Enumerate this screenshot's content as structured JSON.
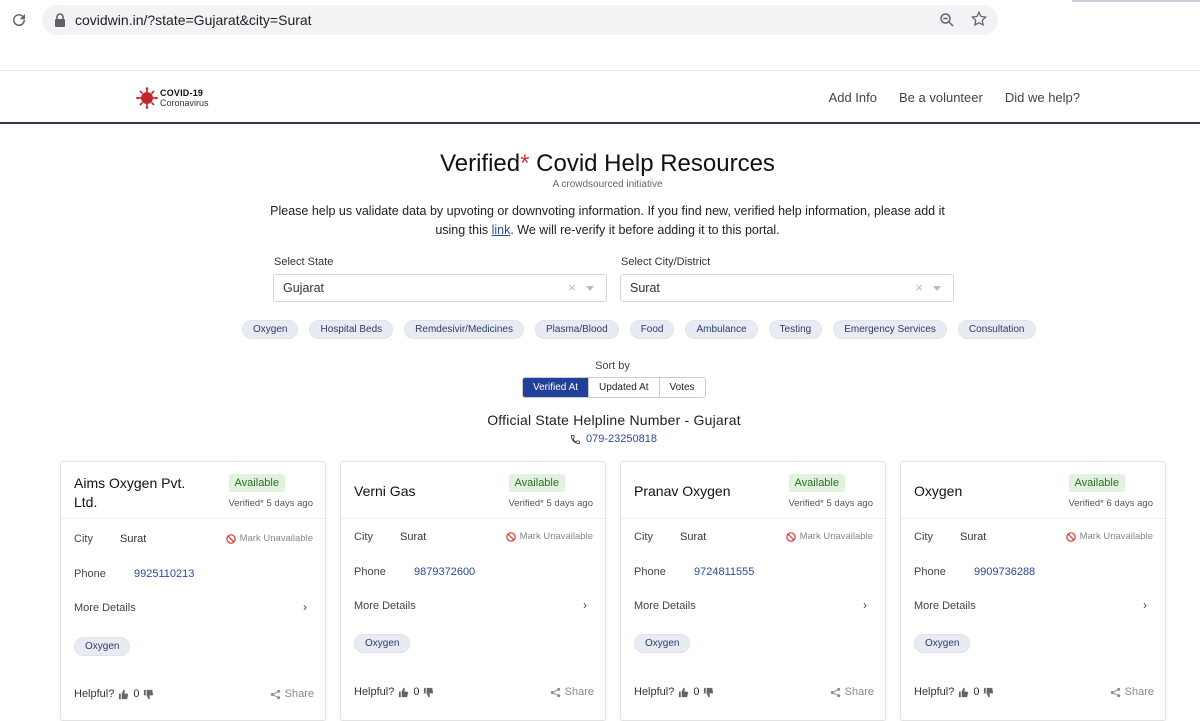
{
  "browser": {
    "url": "covidwin.in/?state=Gujarat&city=Surat"
  },
  "header": {
    "logo_title": "COVID-19",
    "logo_sub": "Coronavirus",
    "nav": [
      "Add Info",
      "Be a volunteer",
      "Did we help?"
    ]
  },
  "hero": {
    "title_a": "Verified",
    "title_star": "*",
    "title_b": " Covid Help Resources",
    "subtitle": "A crowdsourced initiative",
    "desc_1": "Please help us validate data by upvoting or downvoting information. If you find new, verified help information, please add it using this ",
    "desc_link": "link",
    "desc_2": ". We will re-verify it before adding it to this portal."
  },
  "filters": {
    "state_label": "Select State",
    "state_value": "Gujarat",
    "city_label": "Select City/District",
    "city_value": "Surat",
    "clear_glyph": "×"
  },
  "chips": [
    "Oxygen",
    "Hospital Beds",
    "Remdesivir/Medicines",
    "Plasma/Blood",
    "Food",
    "Ambulance",
    "Testing",
    "Emergency Services",
    "Consultation"
  ],
  "sort": {
    "label": "Sort by",
    "options": [
      "Verified At",
      "Updated At",
      "Votes"
    ],
    "active": "Verified At"
  },
  "helpline": {
    "title": "Official State Helpline Number - Gujarat",
    "phone": "079-23250818"
  },
  "card_labels": {
    "city": "City",
    "phone": "Phone",
    "more": "More Details",
    "mark_unavailable": "Mark Unavailable",
    "helpful": "Helpful?",
    "share": "Share",
    "more_chevron": "›"
  },
  "cards": [
    {
      "name": "Aims Oxygen Pvt. Ltd.",
      "status": "Available",
      "verified": "Verified* 5 days ago",
      "city": "Surat",
      "phone": "9925110213",
      "tag": "Oxygen",
      "up": "0"
    },
    {
      "name": "Verni Gas",
      "status": "Available",
      "verified": "Verified* 5 days ago",
      "city": "Surat",
      "phone": "9879372600",
      "tag": "Oxygen",
      "up": "0"
    },
    {
      "name": "Pranav Oxygen",
      "status": "Available",
      "verified": "Verified* 5 days ago",
      "city": "Surat",
      "phone": "9724811555",
      "tag": "Oxygen",
      "up": "0"
    },
    {
      "name": "Oxygen",
      "status": "Available",
      "verified": "Verified* 6 days ago",
      "city": "Surat",
      "phone": "9909736288",
      "tag": "Oxygen",
      "up": "0"
    }
  ],
  "colors": {
    "primary": "#22409a",
    "available_bg": "#dff3dd",
    "header_border": "#2b3a55"
  }
}
